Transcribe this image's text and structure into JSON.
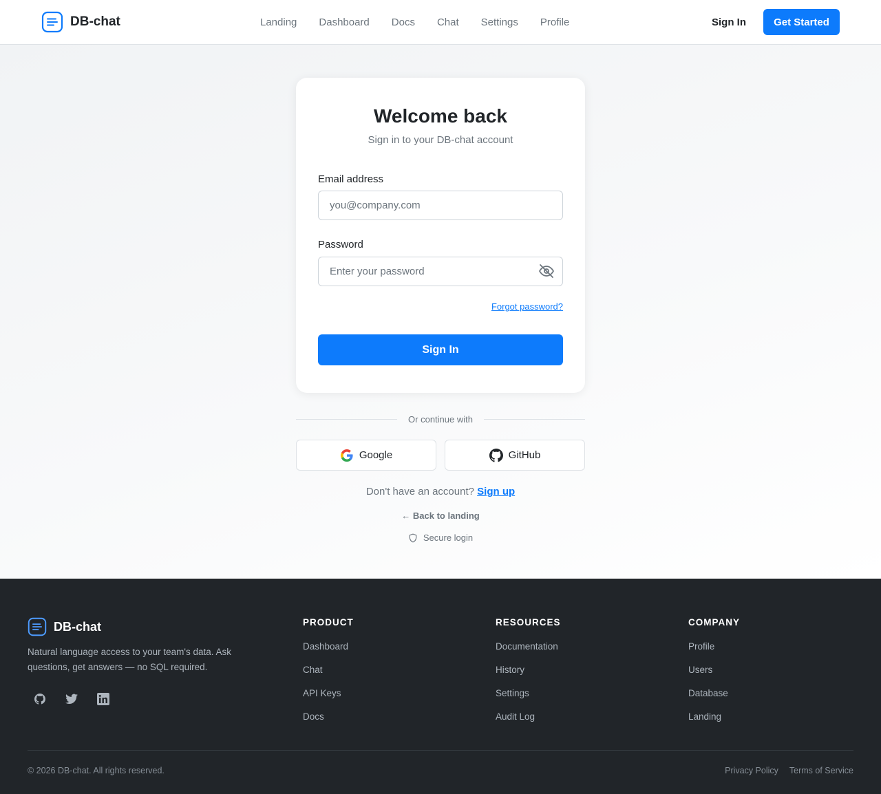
{
  "header": {
    "brand": "DB-chat",
    "nav": [
      "Landing",
      "Dashboard",
      "Docs",
      "Chat",
      "Settings",
      "Profile"
    ],
    "sign_in": "Sign In",
    "get_started": "Get Started"
  },
  "login": {
    "title": "Welcome back",
    "subtitle": "Sign in to your DB-chat account",
    "email_label": "Email address",
    "email_placeholder": "you@company.com",
    "email_value": "",
    "password_label": "Password",
    "password_placeholder": "Enter your password",
    "password_value": "",
    "forgot": "Forgot password?",
    "submit": "Sign In",
    "divider": "Or continue with",
    "google": "Google",
    "github": "GitHub",
    "no_account": "Don't have an account?",
    "signup": "Sign up",
    "back": "← Back to landing",
    "secure": "Secure login"
  },
  "footer": {
    "brand": "DB-chat",
    "description": "Natural language access to your team's data. Ask questions, get answers — no SQL required.",
    "social_icons": [
      "github-icon",
      "twitter-icon",
      "linkedin-icon"
    ],
    "columns": [
      {
        "title": "PRODUCT",
        "links": [
          "Dashboard",
          "Chat",
          "API Keys",
          "Docs"
        ]
      },
      {
        "title": "RESOURCES",
        "links": [
          "Documentation",
          "History",
          "Settings",
          "Audit Log"
        ]
      },
      {
        "title": "COMPANY",
        "links": [
          "Profile",
          "Users",
          "Database",
          "Landing"
        ]
      }
    ],
    "copyright": "© 2026 DB-chat. All rights reserved.",
    "legal": [
      "Privacy Policy",
      "Terms of Service"
    ]
  },
  "colors": {
    "accent": "#0d7bfc",
    "footer_bg": "#212529",
    "text": "#212529",
    "muted": "#6c757d"
  }
}
